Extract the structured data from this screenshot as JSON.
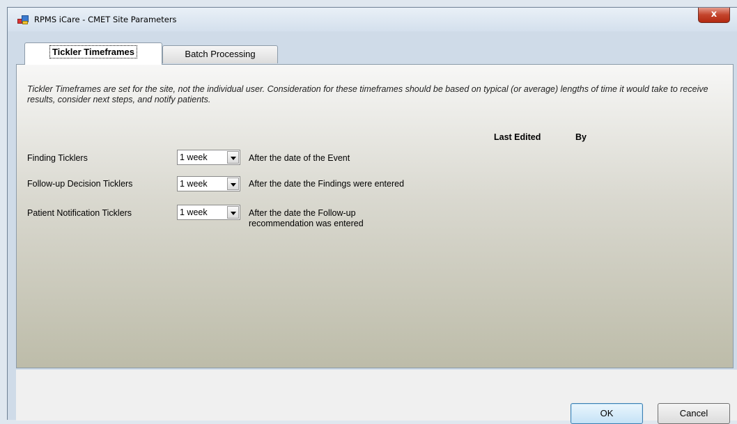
{
  "window": {
    "title": "RPMS iCare - CMET Site Parameters",
    "close_label": "x"
  },
  "tabs": [
    {
      "label": "Tickler Timeframes",
      "active": true
    },
    {
      "label": "Batch Processing",
      "active": false
    }
  ],
  "panel": {
    "description": "Tickler Timeframes are set for the site, not the individual user.  Consideration for these timeframes should be based on typical (or average) lengths of time it would take to receive results, consider next steps, and notify patients.",
    "headers": {
      "last_edited": "Last Edited",
      "by": "By"
    },
    "rows": [
      {
        "label": "Finding Ticklers",
        "value": "1 week",
        "after": "After the date of the Event"
      },
      {
        "label": "Follow-up Decision Ticklers",
        "value": "1 week",
        "after": "After the date the Findings were entered"
      },
      {
        "label": "Patient Notification Ticklers",
        "value": "1 week",
        "after": "After the date the Follow-up recommendation was entered"
      }
    ]
  },
  "buttons": {
    "ok": "OK",
    "cancel": "Cancel"
  }
}
